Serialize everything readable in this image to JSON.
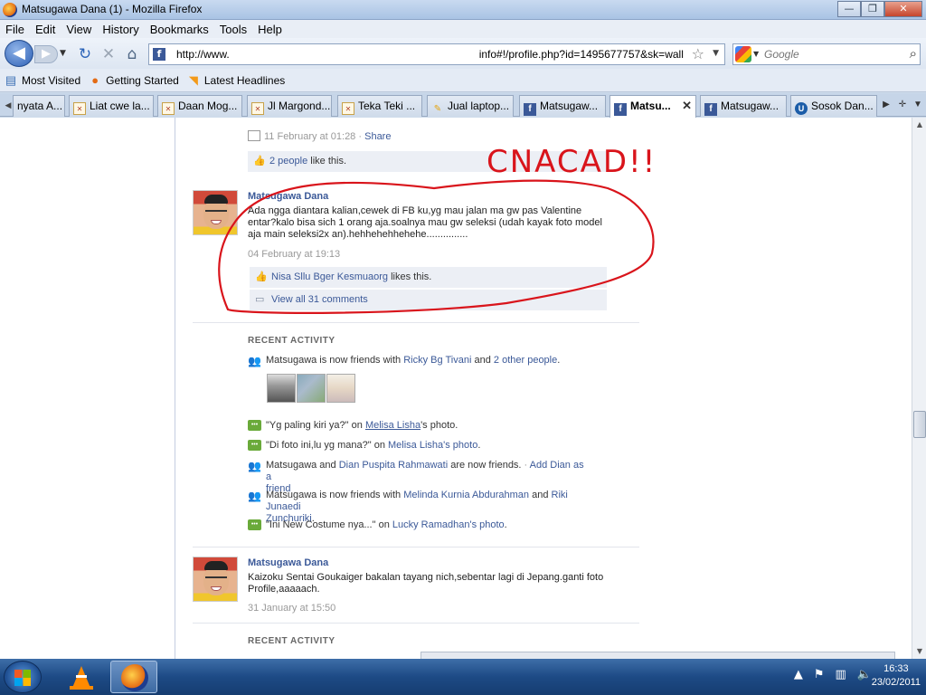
{
  "window": {
    "title": "Matsugawa Dana (1) - Mozilla Firefox",
    "controls": {
      "minimize": "—",
      "maximize": "❐",
      "close": "✕"
    }
  },
  "menu": [
    "File",
    "Edit",
    "View",
    "History",
    "Bookmarks",
    "Tools",
    "Help"
  ],
  "nav": {
    "url_prefix": "http://www.",
    "url_suffix": "info#!/profile.php?id=1495677757&sk=wall",
    "search_placeholder": "Google"
  },
  "bookmarks": [
    "Most Visited",
    "Getting Started",
    "Latest Headlines"
  ],
  "tabs": [
    {
      "label": "nyata A...",
      "icon": "none",
      "active": false
    },
    {
      "label": "Liat cwe la...",
      "icon": "generic",
      "active": false
    },
    {
      "label": "Daan Mog...",
      "icon": "generic",
      "active": false
    },
    {
      "label": "Jl Margond...",
      "icon": "generic",
      "active": false
    },
    {
      "label": "Teka Teki ...",
      "icon": "generic",
      "active": false
    },
    {
      "label": "Jual laptop...",
      "icon": "bulb",
      "active": false
    },
    {
      "label": "Matsugaw...",
      "icon": "facebook",
      "active": false
    },
    {
      "label": "Matsu...",
      "icon": "facebook",
      "active": true
    },
    {
      "label": "Matsugaw...",
      "icon": "facebook",
      "active": false
    },
    {
      "label": "Sosok Dan...",
      "icon": "u",
      "active": false
    }
  ],
  "feed": {
    "prev_post": {
      "timestamp": "11 February at 01:28",
      "separator": "·",
      "share": "Share",
      "likes_link": "2 people",
      "likes_text": "like this."
    },
    "annotation": "CNACAD!!",
    "post1": {
      "author": "Matsugawa Dana",
      "text": "Ada ngga diantara kalian,cewek di FB ku,yg mau jalan ma gw pas Valentine entar?kalo bisa sich 1 orang aja.soalnya mau gw seleksi (udah kayak foto model aja main seleksi2x an).hehhehehhehehe...............",
      "timestamp": "04 February at 19:13",
      "likes_link": "Nisa Sllu Bger Kesmuaorg",
      "likes_text": "likes this.",
      "comments_link": "View all 31 comments"
    },
    "recent_activity_title": "RECENT ACTIVITY",
    "activities": [
      {
        "type": "friend",
        "parts": [
          "Matsugawa is now friends with ",
          "Ricky Bg Tivani",
          " and ",
          "2 other people",
          "."
        ]
      },
      {
        "type": "comment",
        "parts": [
          "\"Yg paling kiri ya?\" on ",
          "Melisa Lisha",
          "'s photo."
        ]
      },
      {
        "type": "comment",
        "parts": [
          "\"Di foto ini,lu yg mana?\" on ",
          "Melisa Lisha's photo",
          "."
        ]
      },
      {
        "type": "friend",
        "parts": [
          "Matsugawa and ",
          "Dian Puspita Rahmawati",
          " are now friends. ",
          "·",
          " Add Dian as a",
          "friend"
        ]
      },
      {
        "type": "friend",
        "parts": [
          "Matsugawa is now friends with ",
          "Melinda Kurnia Abdurahman",
          " and ",
          "Riki Junaedi",
          "Zunchuriki",
          "."
        ]
      },
      {
        "type": "comment",
        "parts": [
          "\"Ini New Costume nya...\" on ",
          "Lucky Ramadhan's photo",
          "."
        ]
      }
    ],
    "post2": {
      "author": "Matsugawa Dana",
      "text": "Kaizoku Sentai Goukaiger bakalan tayang nich,sebentar lagi di Jepang.ganti foto Profile,aaaaach.",
      "timestamp": "31 January at 15:50"
    },
    "recent_activity_title_2": "RECENT ACTIVITY"
  },
  "taskbar": {
    "time": "16:33",
    "date": "23/02/2011"
  },
  "colors": {
    "facebook_link": "#3b5998",
    "annotation_red": "#d9141b",
    "like_box_bg": "#eceff5"
  }
}
